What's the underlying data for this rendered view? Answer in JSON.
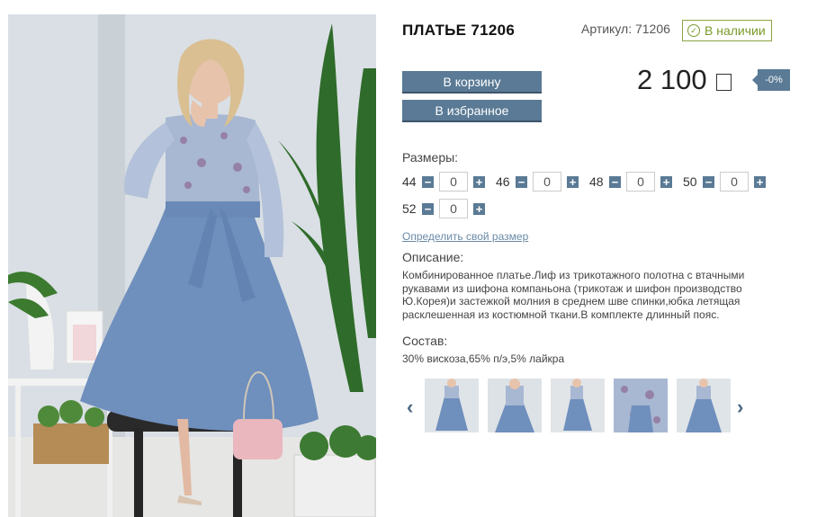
{
  "product": {
    "title": "ПЛАТЬЕ 71206",
    "sku_label": "Артикул: 71206",
    "stock_label": "В наличии",
    "price": "2 100",
    "discount": "-0%"
  },
  "actions": {
    "cart_label": "В корзину",
    "favorite_label": "В избранное"
  },
  "sizes": {
    "label": "Размеры:",
    "items": [
      {
        "size": "44",
        "qty": "0"
      },
      {
        "size": "46",
        "qty": "0"
      },
      {
        "size": "48",
        "qty": "0"
      },
      {
        "size": "50",
        "qty": "0"
      },
      {
        "size": "52",
        "qty": "0"
      }
    ],
    "minus": "−",
    "plus": "+",
    "size_link": "Определить свой размер"
  },
  "description": {
    "label": "Описание:",
    "text": "Комбинированное платье.Лиф из трикотажного  полотна  с втачными рукавами из шифона компаньона (трикотаж и шифон производство Ю.Корея)и застежкой молния в среднем шве спинки,юбка летящая расклешенная из костюмной ткани.В комплекте  длинный пояс."
  },
  "composition": {
    "label": "Состав:",
    "text": "30% вискоза,65% п/э,5% лайкра"
  },
  "gallery": {
    "prev": "‹",
    "next": "›"
  },
  "colors": {
    "accent": "#5a7a95",
    "stock_green": "#7a9a2a"
  }
}
